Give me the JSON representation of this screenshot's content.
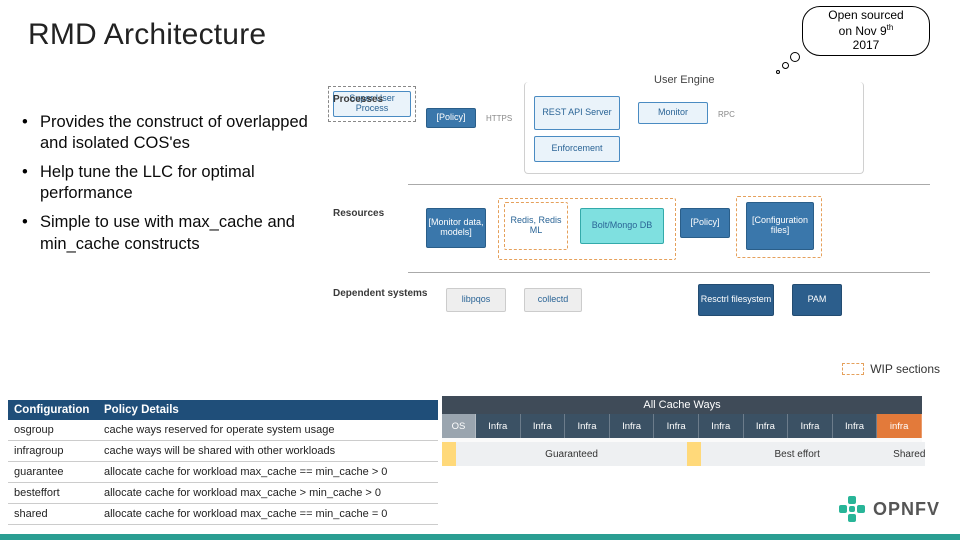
{
  "title": "RMD Architecture",
  "cloud": {
    "line1": "Open sourced",
    "line2_prefix": "on Nov 9",
    "line2_sup": "th",
    "line3": "2017"
  },
  "bullets": [
    "Provides the construct of overlapped and isolated COS'es",
    "Help tune the LLC for optimal performance",
    "Simple to use with max_cache and min_cache constructs"
  ],
  "diagram": {
    "row_labels": [
      "Processes",
      "Resources",
      "Dependent systems"
    ],
    "user_engine_title": "User Engine",
    "policy": "[Policy]",
    "https": "HTTPS",
    "rest": "REST API Server",
    "enforcement": "Enforcement",
    "monitor": "Monitor",
    "rpc": "RPC",
    "super_user": "Super User Process",
    "monitor_data": "[Monitor data, models]",
    "redis": "Redis, Redis ML",
    "bolt": "Bolt/Mongo DB",
    "policy2": "[Policy]",
    "config_files": "[Configuration files]",
    "libpqos": "libpqos",
    "collectd": "collectd",
    "resctrl": "Resctrl filesystem",
    "pam": "PAM"
  },
  "wip_legend": "WIP sections",
  "policy_table": {
    "headers": [
      "Configuration",
      "Policy Details"
    ],
    "rows": [
      {
        "c": "osgroup",
        "d": "cache ways reserved for operate system usage"
      },
      {
        "c": "infragroup",
        "d": "cache ways will be shared with other workloads"
      },
      {
        "c": "guarantee",
        "d": "allocate cache for workload max_cache == min_cache > 0"
      },
      {
        "c": "besteffort",
        "d": "allocate cache for workload max_cache > min_cache > 0"
      },
      {
        "c": "shared",
        "d": "allocate cache for workload max_cache == min_cache = 0"
      }
    ]
  },
  "cache": {
    "header": "All Cache Ways",
    "os": "OS",
    "infra": "Infra",
    "shared_short": "infra",
    "guaranteed": "Guaranteed",
    "besteffort": "Best effort",
    "shared": "Shared"
  },
  "logo": "OPNFV"
}
